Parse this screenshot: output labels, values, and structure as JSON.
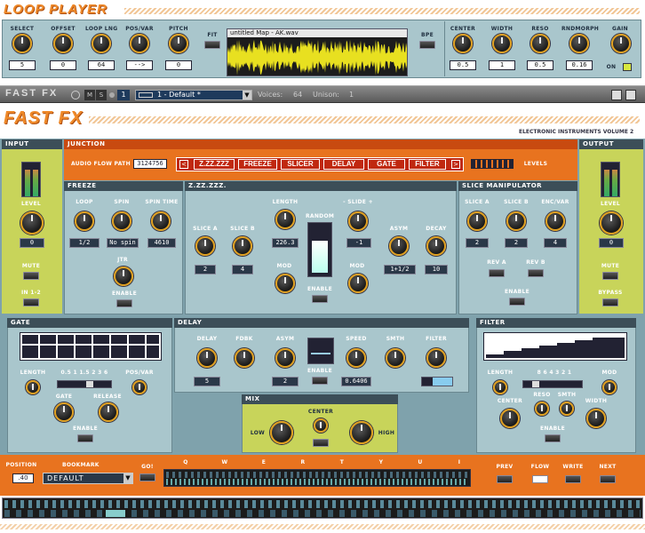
{
  "loop_player": {
    "title": "LOOP PLAYER",
    "left_controls": [
      {
        "label": "SELECT",
        "value": "5"
      },
      {
        "label": "OFFSET",
        "value": "0"
      },
      {
        "label": "LOOP LNG",
        "value": "64"
      },
      {
        "label": "POS/VAR",
        "value": "-->"
      },
      {
        "label": "PITCH",
        "value": "0"
      }
    ],
    "fit_label": "FIT",
    "bpe_label": "BPE",
    "filename": "untitled Map - AK.wav",
    "right_controls": [
      {
        "label": "CENTER",
        "value": "0.5"
      },
      {
        "label": "WIDTH",
        "value": "1"
      },
      {
        "label": "RESO",
        "value": "0.5"
      },
      {
        "label": "RNDMORPH",
        "value": "0.16"
      },
      {
        "label": "GAIN",
        "value": ""
      }
    ],
    "on_label": "ON"
  },
  "toolbar": {
    "title": "FAST FX",
    "m_label": "M",
    "s_label": "S",
    "slot": "1",
    "preset": "1 - Default *",
    "voices_label": "Voices:",
    "voices": "64",
    "unison_label": "Unison:",
    "unison": "1"
  },
  "fastfx": {
    "title": "FAST FX",
    "subtitle": "ELECTRONIC INSTRUMENTS VOLUME 2",
    "input": {
      "title": "INPUT",
      "level_label": "LEVEL",
      "level_value": "0",
      "mute_label": "MUTE",
      "in12_label": "IN 1-2"
    },
    "output": {
      "title": "OUTPUT",
      "level_label": "LEVEL",
      "level_value": "0",
      "mute_label": "MUTE",
      "bypass_label": "BYPASS"
    },
    "junction": {
      "title": "JUNCTION",
      "audio_flow_label": "AUDIO FLOW PATH",
      "audio_flow_value": "3124756",
      "chain": [
        "Z.ZZ.ZZZ",
        "FREEZE",
        "SLICER",
        "DELAY",
        "GATE",
        "FILTER"
      ],
      "levels_label": "LEVELS"
    },
    "freeze": {
      "title": "FREEZE",
      "loop_label": "LOOP",
      "loop_value": "1/2",
      "spin_label": "SPIN",
      "spin_value": "No spin",
      "spin_time_label": "SPIN TIME",
      "spin_time_value": "4610",
      "jtr_label": "JTR",
      "enable_label": "ENABLE"
    },
    "zz": {
      "title": "Z.ZZ.ZZZ.",
      "length_label": "LENGTH",
      "length_value": "226.3",
      "slice_a_label": "SLICE A",
      "slice_a_value": "2",
      "slice_b_label": "SLICE B",
      "slice_b_value": "4",
      "random_label": "RANDOM",
      "slide_label": "- SLIDE +",
      "slide_value": "-1",
      "asym_label": "ASYM",
      "asym_value": "1+1/2",
      "decay_label": "DECAY",
      "decay_value": "10",
      "mod_label": "MOD",
      "mod2_label": "MOD",
      "enable_label": "ENABLE"
    },
    "slice": {
      "title": "SLICE MANIPULATOR",
      "slice_a_label": "SLICE A",
      "slice_a_value": "2",
      "slice_b_label": "SLICE B",
      "slice_b_value": "2",
      "encvar_label": "ENC/VAR",
      "encvar_value": "4",
      "rev_a_label": "REV A",
      "rev_b_label": "REV B",
      "enable_label": "ENABLE"
    },
    "gate": {
      "title": "GATE",
      "length_label": "LENGTH",
      "length_marks": "0.5 1 1.5 2 3 6",
      "posvar_label": "POS/VAR",
      "gate_label": "GATE",
      "release_label": "RELEASE",
      "enable_label": "ENABLE"
    },
    "delay": {
      "title": "DELAY",
      "delay_label": "DELAY",
      "delay_value": "5",
      "fdbk_label": "FDBK",
      "asym_label": "ASYM",
      "asym_value": "2",
      "speed_label": "SPEED",
      "speed_value": "0.6406",
      "smth_label": "SMTH",
      "filter_label": "FILTER",
      "enable_label": "ENABLE"
    },
    "mix": {
      "title": "MIX",
      "low_label": "LOW",
      "center_label": "CENTER",
      "high_label": "HIGH"
    },
    "filter": {
      "title": "FILTER",
      "length_label": "LENGTH",
      "length_marks": "8 6 4 3 2 1",
      "mod_label": "MOD",
      "center_label": "CENTER",
      "reso_label": "RESO",
      "smth_label": "SMTH",
      "width_label": "WIDTH",
      "enable_label": "ENABLE"
    },
    "bottom": {
      "position_label": "POSITION",
      "position_value": ".40",
      "bookmark_label": "BOOKMARK",
      "bookmark_value": "DEFAULT",
      "go_label": "GO!",
      "keys": [
        "Q",
        "W",
        "E",
        "R",
        "T",
        "Y",
        "U",
        "I"
      ],
      "prev_label": "PREV",
      "flow_label": "FLOW",
      "write_label": "WRITE",
      "next_label": "NEXT"
    }
  },
  "colors": {
    "orange": "#e8731f",
    "teal": "#9fbcc2",
    "lime": "#c8d45a",
    "dark": "#3c4e58"
  }
}
